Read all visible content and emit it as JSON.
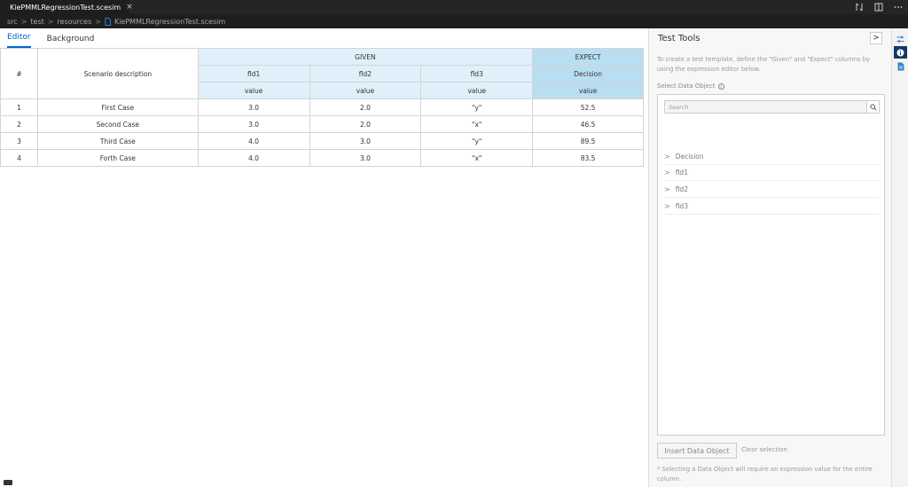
{
  "window": {
    "tab_title": "KiePMMLRegressionTest.scesim",
    "close_glyph": "×"
  },
  "breadcrumb": {
    "parts": [
      "src",
      "test",
      "resources",
      "KiePMMLRegressionTest.scesim"
    ],
    "separator": ">"
  },
  "editor": {
    "tabs": [
      "Editor",
      "Background"
    ],
    "active_tab": "Editor"
  },
  "table": {
    "num_header": "#",
    "desc_header": "Scenario description",
    "given_header": "GIVEN",
    "expect_header": "EXPECT",
    "fields": [
      "fld1",
      "fld2",
      "fld3",
      "Decision"
    ],
    "value_label": "value",
    "rows": [
      {
        "n": "1",
        "desc": "First Case",
        "fld1": "3.0",
        "fld2": "2.0",
        "fld3": "\"y\"",
        "decision": "52.5"
      },
      {
        "n": "2",
        "desc": "Second Case",
        "fld1": "3.0",
        "fld2": "2.0",
        "fld3": "\"x\"",
        "decision": "46.5"
      },
      {
        "n": "3",
        "desc": "Third Case",
        "fld1": "4.0",
        "fld2": "3.0",
        "fld3": "\"y\"",
        "decision": "89.5"
      },
      {
        "n": "4",
        "desc": "Forth Case",
        "fld1": "4.0",
        "fld2": "3.0",
        "fld3": "\"x\"",
        "decision": "83.5"
      }
    ]
  },
  "panel": {
    "title": "Test Tools",
    "collapse_glyph": ">",
    "description": "To create a test template, define the \"Given\" and \"Expect\" columns by using the expression editor below.",
    "select_label": "Select Data Object",
    "search_placeholder": "Search",
    "tree": [
      "Decision",
      "fld1",
      "fld2",
      "fld3"
    ],
    "chevron": ">",
    "insert_button": "Insert Data Object",
    "clear_link": "Clear selection",
    "note": "* Selecting a Data Object will require an expression value for the entire column."
  },
  "colors": {
    "given_bg": "#dff0fb",
    "expect_bg": "#b9def2",
    "accent": "#0066cc"
  }
}
